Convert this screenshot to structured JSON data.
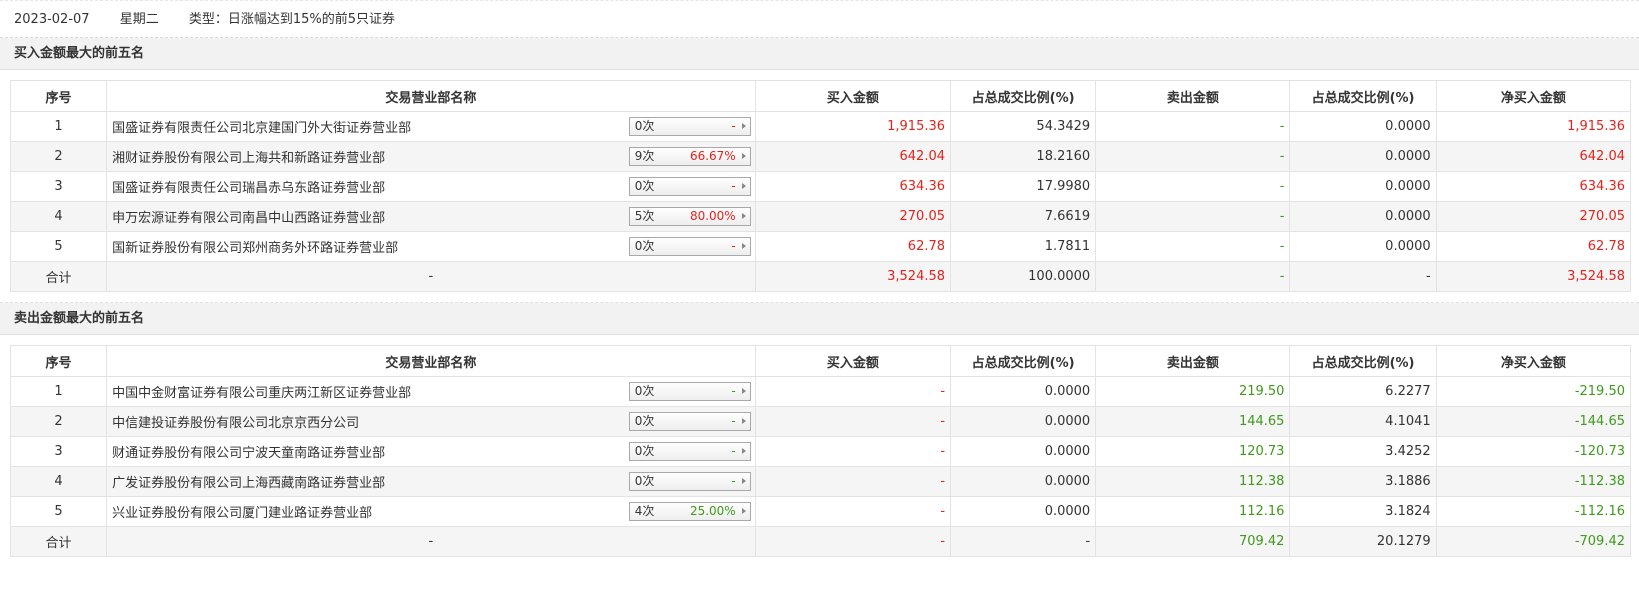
{
  "header": {
    "date": "2023-02-07",
    "weekday": "星期二",
    "type": "类型：日涨幅达到15%的前5只证券"
  },
  "columns": [
    "序号",
    "交易营业部名称",
    "买入金额",
    "占总成交比例(%)",
    "卖出金额",
    "占总成交比例(%)",
    "净买入金额"
  ],
  "colors": {
    "positive": "#e4231c",
    "negative": "#3f9a1b"
  },
  "buy_section": {
    "title": "买入金额最大的前五名",
    "rows": [
      {
        "idx": "1",
        "name": "国盛证券有限责任公司北京建国门外大街证券营业部",
        "times": "0次",
        "rate": "-",
        "buy": "1,915.36",
        "buy_pct": "54.3429",
        "sell": "-",
        "sell_pct": "0.0000",
        "net": "1,915.36"
      },
      {
        "idx": "2",
        "name": "湘财证券股份有限公司上海共和新路证券营业部",
        "times": "9次",
        "rate": "66.67%",
        "buy": "642.04",
        "buy_pct": "18.2160",
        "sell": "-",
        "sell_pct": "0.0000",
        "net": "642.04"
      },
      {
        "idx": "3",
        "name": "国盛证券有限责任公司瑞昌赤乌东路证券营业部",
        "times": "0次",
        "rate": "-",
        "buy": "634.36",
        "buy_pct": "17.9980",
        "sell": "-",
        "sell_pct": "0.0000",
        "net": "634.36"
      },
      {
        "idx": "4",
        "name": "申万宏源证券有限公司南昌中山西路证券营业部",
        "times": "5次",
        "rate": "80.00%",
        "buy": "270.05",
        "buy_pct": "7.6619",
        "sell": "-",
        "sell_pct": "0.0000",
        "net": "270.05"
      },
      {
        "idx": "5",
        "name": "国新证券股份有限公司郑州商务外环路证券营业部",
        "times": "0次",
        "rate": "-",
        "buy": "62.78",
        "buy_pct": "1.7811",
        "sell": "-",
        "sell_pct": "0.0000",
        "net": "62.78"
      }
    ],
    "total": {
      "label": "合计",
      "name": "-",
      "buy": "3,524.58",
      "buy_pct": "100.0000",
      "sell": "-",
      "sell_pct": "-",
      "net": "3,524.58"
    }
  },
  "sell_section": {
    "title": "卖出金额最大的前五名",
    "rows": [
      {
        "idx": "1",
        "name": "中国中金财富证券有限公司重庆两江新区证券营业部",
        "times": "0次",
        "rate": "-",
        "buy": "-",
        "buy_pct": "0.0000",
        "sell": "219.50",
        "sell_pct": "6.2277",
        "net": "-219.50"
      },
      {
        "idx": "2",
        "name": "中信建投证券股份有限公司北京京西分公司",
        "times": "0次",
        "rate": "-",
        "buy": "-",
        "buy_pct": "0.0000",
        "sell": "144.65",
        "sell_pct": "4.1041",
        "net": "-144.65"
      },
      {
        "idx": "3",
        "name": "财通证券股份有限公司宁波天童南路证券营业部",
        "times": "0次",
        "rate": "-",
        "buy": "-",
        "buy_pct": "0.0000",
        "sell": "120.73",
        "sell_pct": "3.4252",
        "net": "-120.73"
      },
      {
        "idx": "4",
        "name": "广发证券股份有限公司上海西藏南路证券营业部",
        "times": "0次",
        "rate": "-",
        "buy": "-",
        "buy_pct": "0.0000",
        "sell": "112.38",
        "sell_pct": "3.1886",
        "net": "-112.38"
      },
      {
        "idx": "5",
        "name": "兴业证券股份有限公司厦门建业路证券营业部",
        "times": "4次",
        "rate": "25.00%",
        "buy": "-",
        "buy_pct": "0.0000",
        "sell": "112.16",
        "sell_pct": "3.1824",
        "net": "-112.16"
      }
    ],
    "total": {
      "label": "合计",
      "name": "-",
      "buy": "-",
      "buy_pct": "-",
      "sell": "709.42",
      "sell_pct": "20.1279",
      "net": "-709.42"
    }
  }
}
